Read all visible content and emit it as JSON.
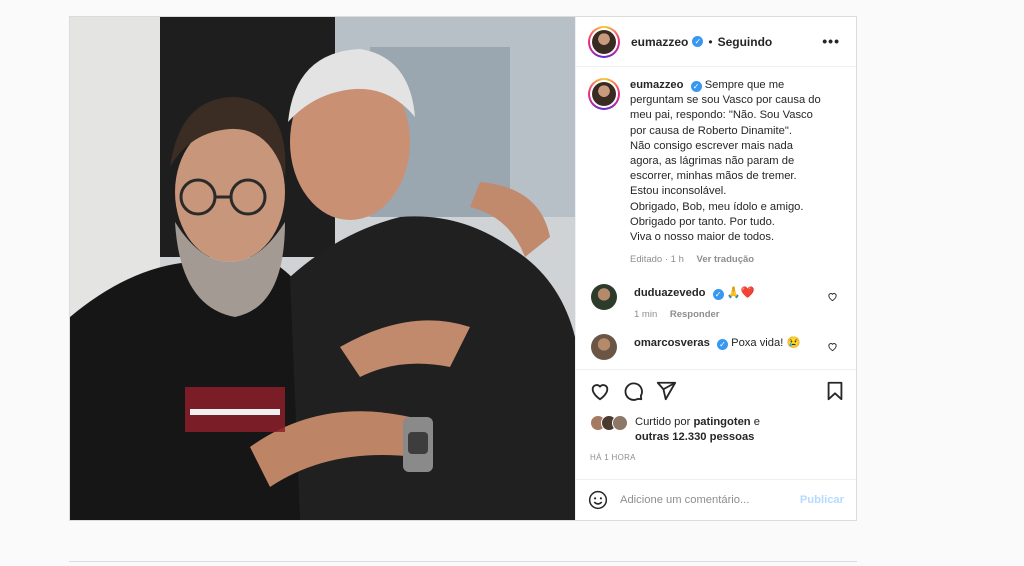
{
  "post": {
    "username": "eumazzeo",
    "dot": "•",
    "following": "Seguindo",
    "more": "•••",
    "caption_user": "eumazzeo",
    "caption_lines": [
      "Sempre que me",
      "perguntam se sou Vasco por causa do",
      "meu pai, respondo: \"Não. Sou Vasco",
      "por causa de Roberto Dinamite\".",
      "Não consigo escrever mais nada",
      "agora, as lágrimas não param de",
      "escorrer, minhas mãos de tremer.",
      "Estou inconsolável.",
      "Obrigado, Bob, meu ídolo e amigo.",
      "Obrigado por tanto. Por tudo.",
      "Viva o nosso maior de todos."
    ],
    "caption_meta": {
      "edited": "Editado · 1 h",
      "translate": "Ver tradução"
    },
    "comments": [
      {
        "user": "duduazevedo",
        "text": "🙏❤️",
        "time": "1 min",
        "reply": "Responder"
      },
      {
        "user": "omarcosveras",
        "text": "Poxa vida! 😢"
      }
    ],
    "likes": {
      "prefix": "Curtido por",
      "user": "patingoten",
      "suffix": "e",
      "others": "outras 12.330 pessoas"
    },
    "time_ago": "HÁ 1 HORA",
    "add_comment_placeholder": "Adicione um comentário...",
    "publish": "Publicar",
    "verified_mark": "✓"
  },
  "icons": [
    "heart-icon",
    "comment-icon",
    "share-icon",
    "bookmark-icon",
    "emoji-icon",
    "more-icon"
  ],
  "colors": {
    "verified": "#3897f0",
    "heart_red": "#ed4956",
    "publish_disabled": "#b3dbff"
  }
}
